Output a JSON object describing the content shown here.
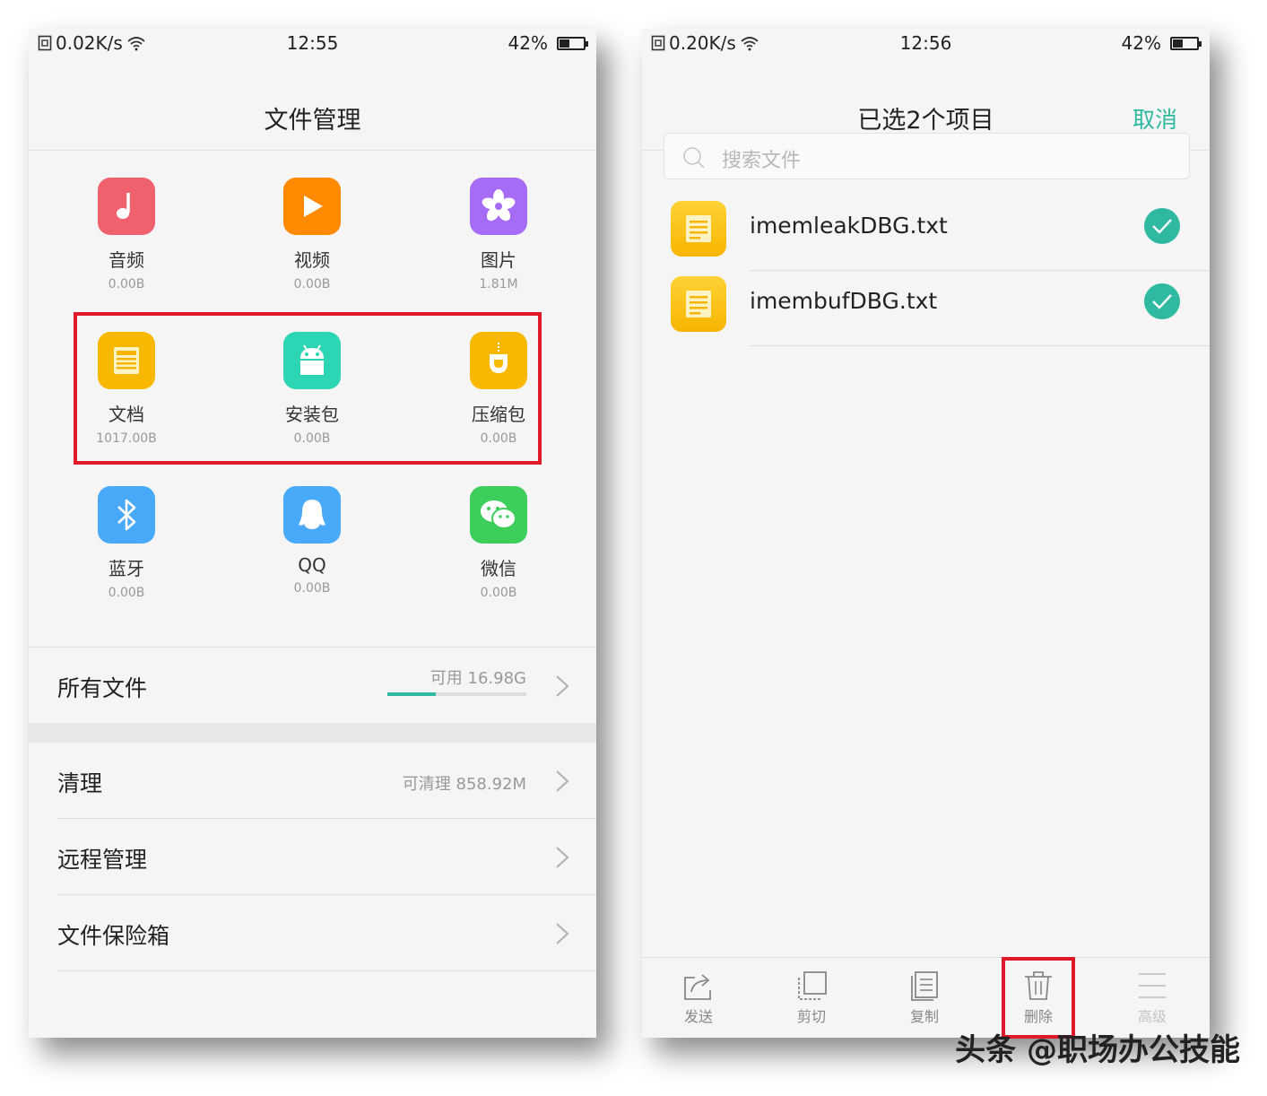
{
  "left_screen": {
    "status": {
      "speed": "0.02K/s",
      "time": "12:55",
      "battery": "42%",
      "battery_level_pct": 42
    },
    "title": "文件管理",
    "categories": [
      {
        "name": "音频",
        "size": "0.00B",
        "icon": "music-note-icon",
        "color": "#f0616e"
      },
      {
        "name": "视频",
        "size": "0.00B",
        "icon": "play-icon",
        "color": "#ff8a00"
      },
      {
        "name": "图片",
        "size": "1.81M",
        "icon": "flower-icon",
        "color": "#a66cf5"
      },
      {
        "name": "文档",
        "size": "1017.00B",
        "icon": "document-icon",
        "color": "#f9b800"
      },
      {
        "name": "安装包",
        "size": "0.00B",
        "icon": "android-icon",
        "color": "#2cd6b4"
      },
      {
        "name": "压缩包",
        "size": "0.00B",
        "icon": "zip-icon",
        "color": "#f9b800"
      },
      {
        "name": "蓝牙",
        "size": "0.00B",
        "icon": "bluetooth-icon",
        "color": "#48a9f8"
      },
      {
        "name": "QQ",
        "size": "0.00B",
        "icon": "qq-penguin-icon",
        "color": "#48a9f8"
      },
      {
        "name": "微信",
        "size": "0.00B",
        "icon": "wechat-icon",
        "color": "#3ccd5a"
      }
    ],
    "all_files": {
      "label": "所有文件",
      "available": "可用 16.98G",
      "used_fraction": 0.35
    },
    "menu": [
      {
        "label": "清理",
        "meta": "可清理 858.92M"
      },
      {
        "label": "远程管理",
        "meta": ""
      },
      {
        "label": "文件保险箱",
        "meta": ""
      }
    ]
  },
  "right_screen": {
    "status": {
      "speed": "0.20K/s",
      "time": "12:56",
      "battery": "42%",
      "battery_level_pct": 42
    },
    "title": "已选2个项目",
    "cancel": "取消",
    "search_placeholder": "搜索文件",
    "files": [
      {
        "name": "imemleakDBG.txt",
        "selected": true
      },
      {
        "name": "imembufDBG.txt",
        "selected": true
      }
    ],
    "toolbar": [
      {
        "label": "发送",
        "icon": "share-icon",
        "enabled": true
      },
      {
        "label": "剪切",
        "icon": "cut-icon",
        "enabled": true
      },
      {
        "label": "复制",
        "icon": "copy-icon",
        "enabled": true
      },
      {
        "label": "删除",
        "icon": "trash-icon",
        "enabled": true,
        "highlighted": true
      },
      {
        "label": "高级",
        "icon": "menu-icon",
        "enabled": false
      }
    ]
  },
  "watermark": "头条 @职场办公技能",
  "colors": {
    "accent": "#2fb9a0",
    "highlight": "#e0192a"
  }
}
